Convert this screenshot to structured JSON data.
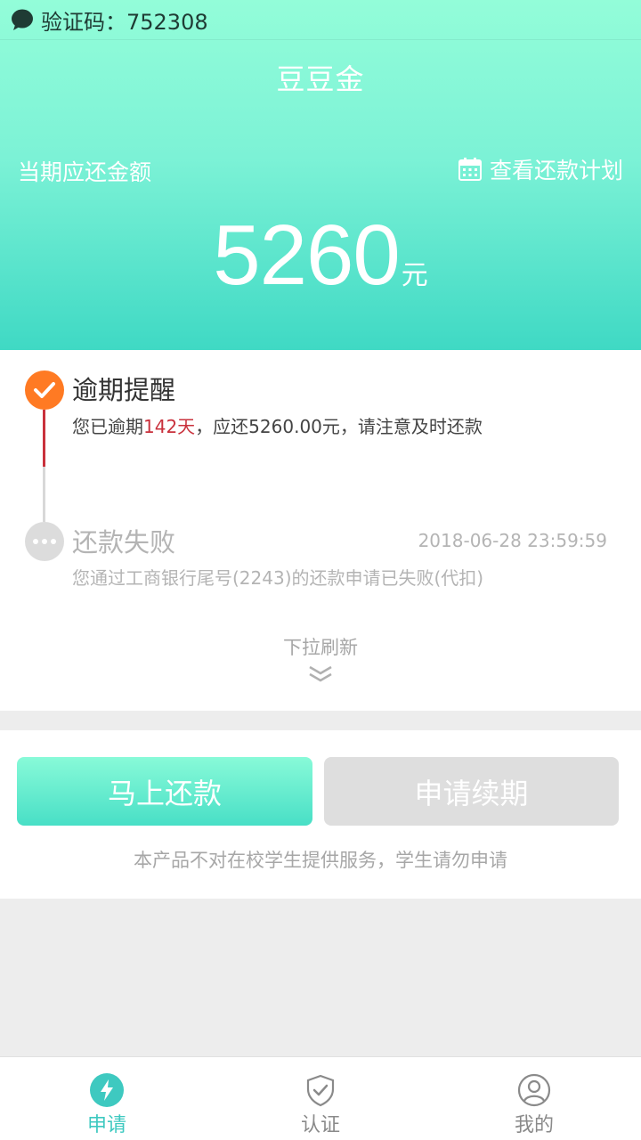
{
  "status_bar": {
    "code_text": "验证码：752308"
  },
  "header": {
    "title": "豆豆金",
    "due_label": "当期应还金额",
    "plan_link": "查看还款计划",
    "amount": "5260",
    "unit": "元"
  },
  "timeline": {
    "event1": {
      "title": "逾期提醒",
      "desc_prefix": "您已逾期",
      "overdue_days": "142天",
      "desc_suffix": "，应还5260.00元，请注意及时还款"
    },
    "event2": {
      "title": "还款失败",
      "time": "2018-06-28 23:59:59",
      "desc": "您通过工商银行尾号(2243)的还款申请已失败(代扣)"
    },
    "pull_text": "下拉刷新"
  },
  "actions": {
    "pay_label": "马上还款",
    "renew_label": "申请续期",
    "notice": "本产品不对在校学生提供服务，学生请勿申请"
  },
  "tabbar": {
    "items": [
      {
        "label": "申请",
        "icon": "lightning-icon",
        "active": true
      },
      {
        "label": "认证",
        "icon": "shield-check-icon",
        "active": false
      },
      {
        "label": "我的",
        "icon": "user-icon",
        "active": false
      }
    ]
  },
  "colors": {
    "accent": "#3fd9c4",
    "tab_active": "#3ec9c0",
    "tab_inactive": "#8a8a8a",
    "overdue_red": "#c9313c",
    "alert_orange": "#ff7a23"
  }
}
